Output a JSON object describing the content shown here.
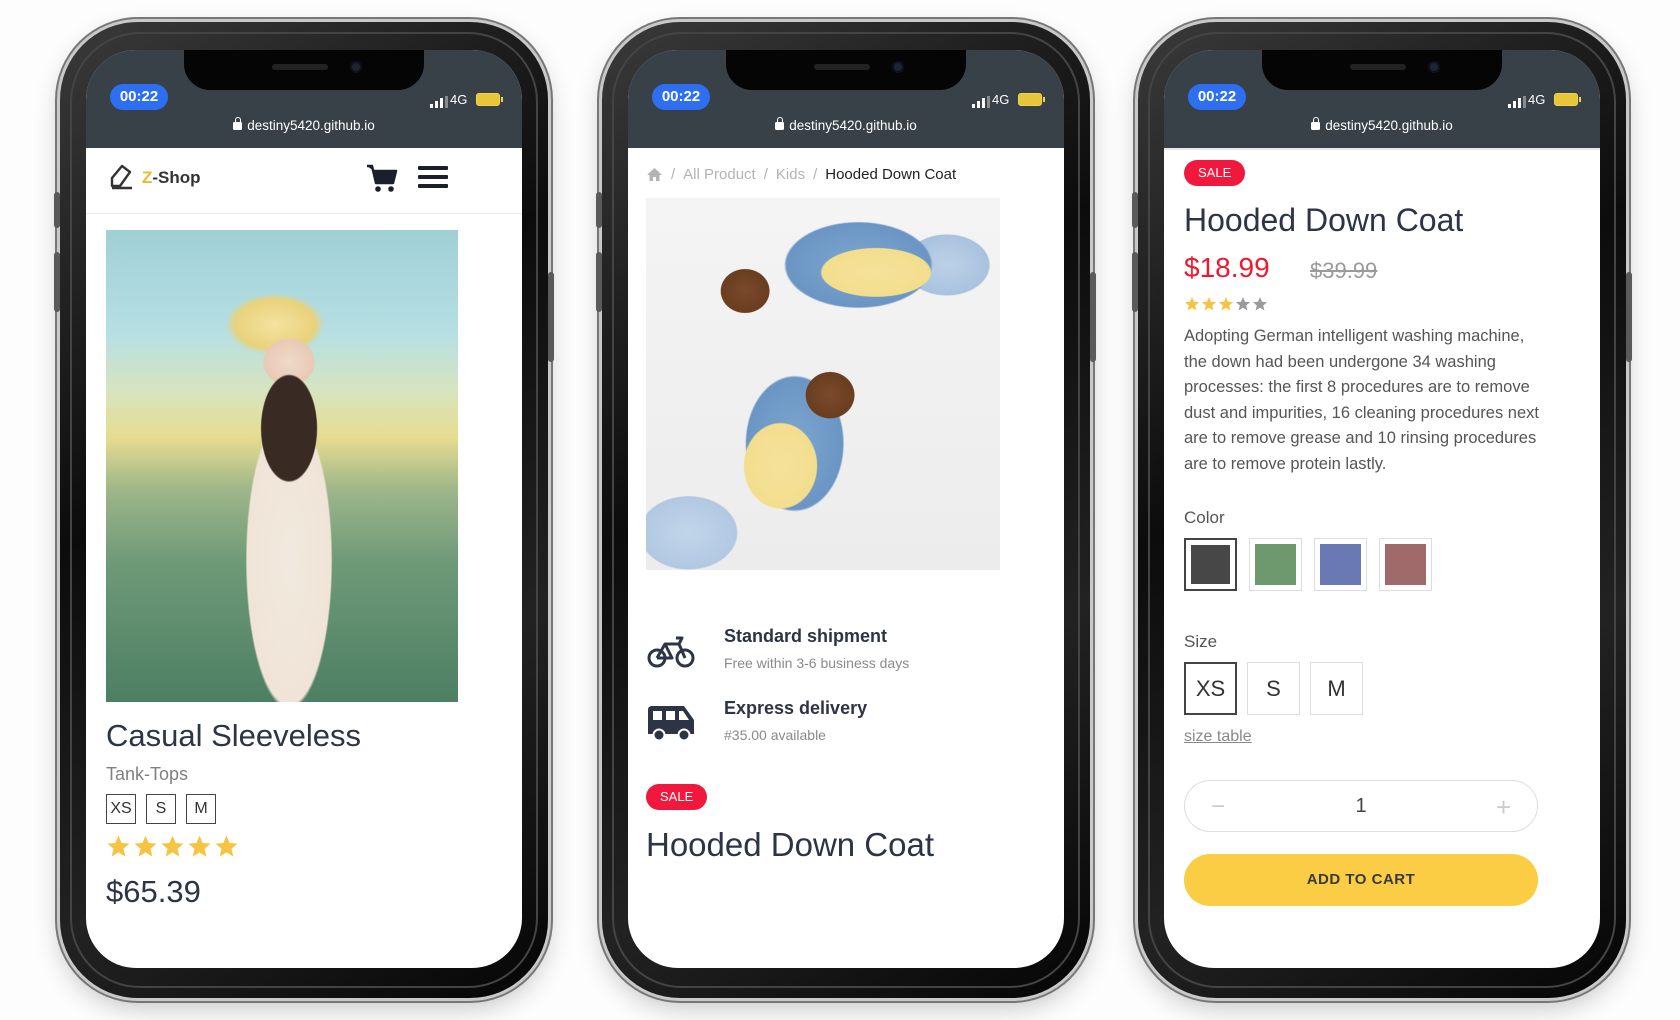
{
  "status": {
    "time": "00:22",
    "network": "4G",
    "url": "destiny5420.github.io"
  },
  "phone1": {
    "brand": {
      "prefix": "Z",
      "name": "-Shop"
    },
    "product": {
      "title": "Casual Sleeveless",
      "category": "Tank-Tops",
      "sizes": [
        "XS",
        "S",
        "M"
      ],
      "rating": 5,
      "price": "$65.39"
    },
    "icons": [
      "logo-icon",
      "cart-icon",
      "menu-icon",
      "star-icon"
    ],
    "colors": {
      "star": "#f6c342",
      "text": "#2c3445"
    }
  },
  "phone2": {
    "breadcrumb": {
      "sep": "/",
      "items": [
        "All Product",
        "Kids"
      ],
      "current": "Hooded Down Coat"
    },
    "shipping": [
      {
        "title": "Standard shipment",
        "subtitle": "Free within 3-6 business days",
        "icon": "bicycle-icon"
      },
      {
        "title": "Express delivery",
        "subtitle": "#35.00 available",
        "icon": "van-icon"
      }
    ],
    "badge": "SALE",
    "title": "Hooded Down Coat"
  },
  "phone3": {
    "badge": "SALE",
    "title": "Hooded Down Coat",
    "price": "$18.99",
    "old_price": "$39.99",
    "rating": 3,
    "rating_max": 5,
    "description": "Adopting German intelligent washing machine, the down had been undergone 34 washing processes: the first 8 procedures are to remove dust and impurities, 16 cleaning procedures next are to remove grease and 10 rinsing procedures are to remove protein lastly.",
    "color_label": "Color",
    "colors": [
      "#474747",
      "#6e996e",
      "#6a78b4",
      "#a06a6a"
    ],
    "selected_color": 0,
    "size_label": "Size",
    "sizes": [
      "XS",
      "S",
      "M"
    ],
    "selected_size": 0,
    "size_table": "size table",
    "quantity": {
      "minus": "−",
      "value": "1",
      "plus": "+"
    },
    "add_to_cart": "ADD TO CART",
    "accent": "#fbcd45",
    "sale_color": "#f0183c"
  }
}
